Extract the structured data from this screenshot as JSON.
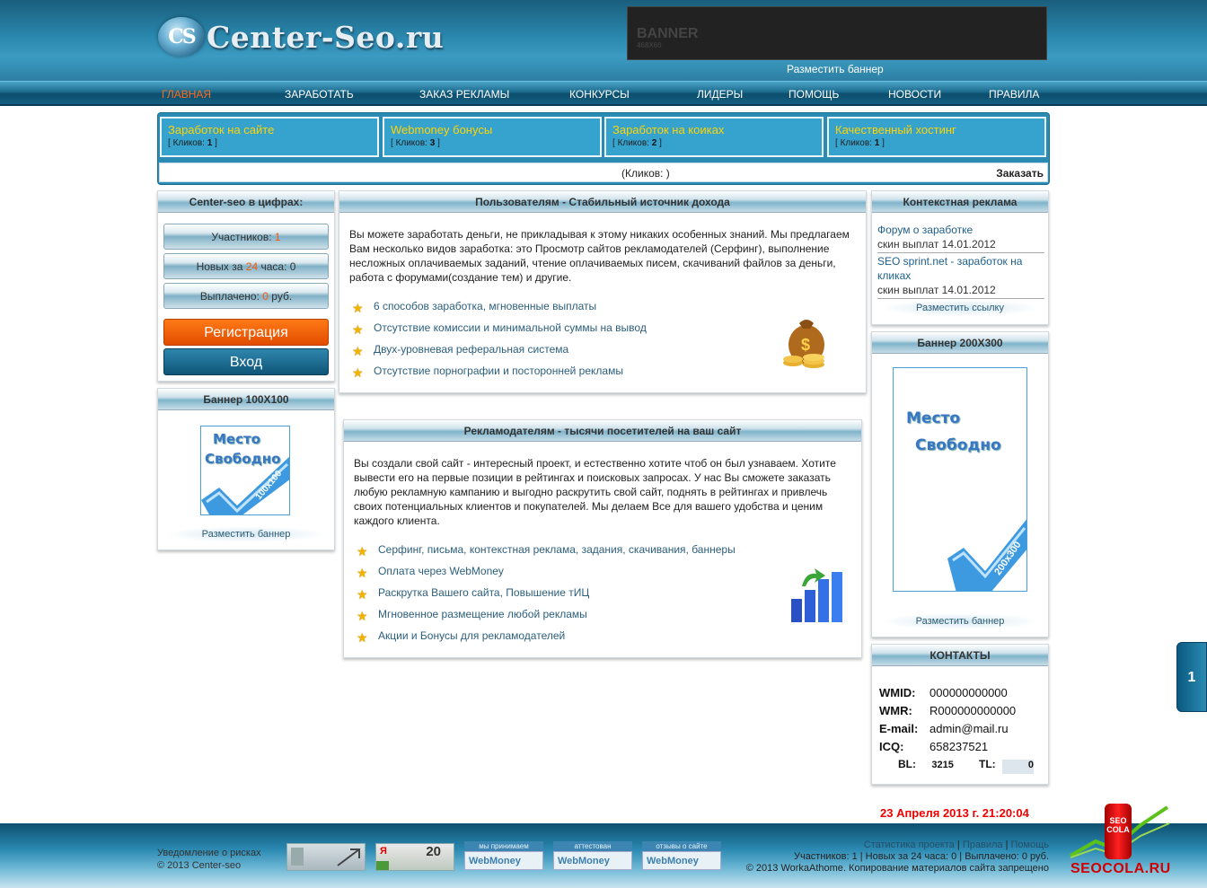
{
  "header": {
    "logo_mark": "CS",
    "logo_text": "Center-Seo.ru",
    "banner_title": "BANNER",
    "banner_size": "468X60",
    "place_banner": "Разместить баннер"
  },
  "nav": {
    "items": [
      "ГЛАВНАЯ",
      "ЗАРАБОТАТЬ",
      "ЗАКАЗ РЕКЛАМЫ",
      "КОНКУРСЫ",
      "ЛИДЕРЫ",
      "ПОМОЩЬ",
      "НОВОСТИ",
      "ПРАВИЛА"
    ]
  },
  "top_links": {
    "items": [
      {
        "title": "Заработок на сайте",
        "clicks_label": "Кликов:",
        "clicks": "1"
      },
      {
        "title": "Webmoney бонусы",
        "clicks_label": "Кликов:",
        "clicks": "3"
      },
      {
        "title": "Заработок на коиках",
        "clicks_label": "Кликов:",
        "clicks": "2"
      },
      {
        "title": "Качественный хостинг",
        "clicks_label": "Кликов:",
        "clicks": "1"
      }
    ],
    "bottom_clicks": "(Кликов: )",
    "order": "Заказать"
  },
  "stats": {
    "title": "Center-seo в цифрах:",
    "members_label": "Участников:",
    "members": "1",
    "new_label_a": "Новых за",
    "new_hours": "24",
    "new_label_b": "часа: 0",
    "paid_label": "Выплачено:",
    "paid": "0",
    "paid_unit": "руб.",
    "register": "Регистрация",
    "login": "Вход"
  },
  "banner100": {
    "title": "Баннер 100X100",
    "text1": "Место",
    "text2": "Свободно",
    "size": "100x100",
    "place": "Разместить баннер"
  },
  "users": {
    "title": "Пользователям - Стабильный источник дохода",
    "text": "Вы можете заработать деньги, не прикладывая к этому никаких особенных знаний. Мы предлагаем Вам несколько видов заработка: это Просмотр сайтов рекламодателей (Серфинг), выполнение несложных оплачиваемых заданий, чтение оплачиваемых писем, скачиваний файлов за деньги, работа с форумами(создание тем) и другие.",
    "list": [
      "6 способов заработка, мгновенные выплаты",
      "Отсутствие комиссии и минимальной суммы на вывод",
      "Двух-уровневая реферальная система",
      "Отсутствие порнографии и посторонней рекламы"
    ]
  },
  "advertisers": {
    "title": "Рекламодателям - тысячи посетителей на ваш сайт",
    "text": "Вы создали свой сайт - интересный проект, и естественно хотите чтоб он был узнаваем. Хотите вывести его на первые позиции в рейтингах и поисковых запросах. У нас Вы сможете заказать любую рекламную кампанию и выгодно раскрутить свой сайт, поднять в рейтингах и привлечь своих потенциальных клиентов и покупателей. Мы делаем Все для вашего удобства и ценим каждого клиента.",
    "list": [
      "Серфинг, письма, контекстная реклама, задания, скачивания, баннеры",
      "Оплата через WebMoney",
      "Раскрутка Вашего сайта, Повышение тИЦ",
      "Мгновенное размещение любой рекламы",
      "Акции и Бонусы для рекламодателей"
    ]
  },
  "context": {
    "title": "Контекстная реклама",
    "items": [
      {
        "link": "Форум о заработке",
        "sub": "скин выплат 14.01.2012"
      },
      {
        "link": "SEO sprint.net - заработок на кликах",
        "sub": "скин выплат 14.01.2012"
      }
    ],
    "place": "Разместить ссылку"
  },
  "banner200": {
    "title": "Баннер 200X300",
    "text1": "Место",
    "text2": "Свободно",
    "size": "200x300",
    "place": "Разместить баннер"
  },
  "contacts": {
    "title": "КОНТАКТЫ",
    "rows": [
      {
        "label": "WMID:",
        "value": "000000000000"
      },
      {
        "label": "WMR:",
        "value": "R000000000000"
      },
      {
        "label": "E-mail:",
        "value": "admin@mail.ru"
      },
      {
        "label": "ICQ:",
        "value": "658237521"
      }
    ],
    "bl_label": "BL:",
    "bl": "3215",
    "tl_label": "TL:",
    "tl": "0"
  },
  "date": "23 Апреля 2013 г. 21:20:04",
  "side_tab": "1",
  "footer": {
    "risk": "Уведомление о рисках",
    "copy_left": "© 2013 Center-seo",
    "wm_buttons": [
      {
        "h": "мы принимаем",
        "b": "WebMoney"
      },
      {
        "h": "аттестован",
        "b": "WebMoney"
      },
      {
        "h": "отзывы о сайте",
        "b": "WebMoney"
      }
    ],
    "counter_a": "20",
    "links": [
      "Статистика проекта",
      "Правила",
      "Помощь"
    ],
    "stats_line": "Участников: 1 | Новых за 24 часа: 0 | Выплачено: 0 руб.",
    "copy_right": "© 2013 WorkaAthome. Копирование материалов сайта запрещено",
    "seocola_can": "SEO COLA",
    "seocola": "SEOCOLA.RU"
  }
}
